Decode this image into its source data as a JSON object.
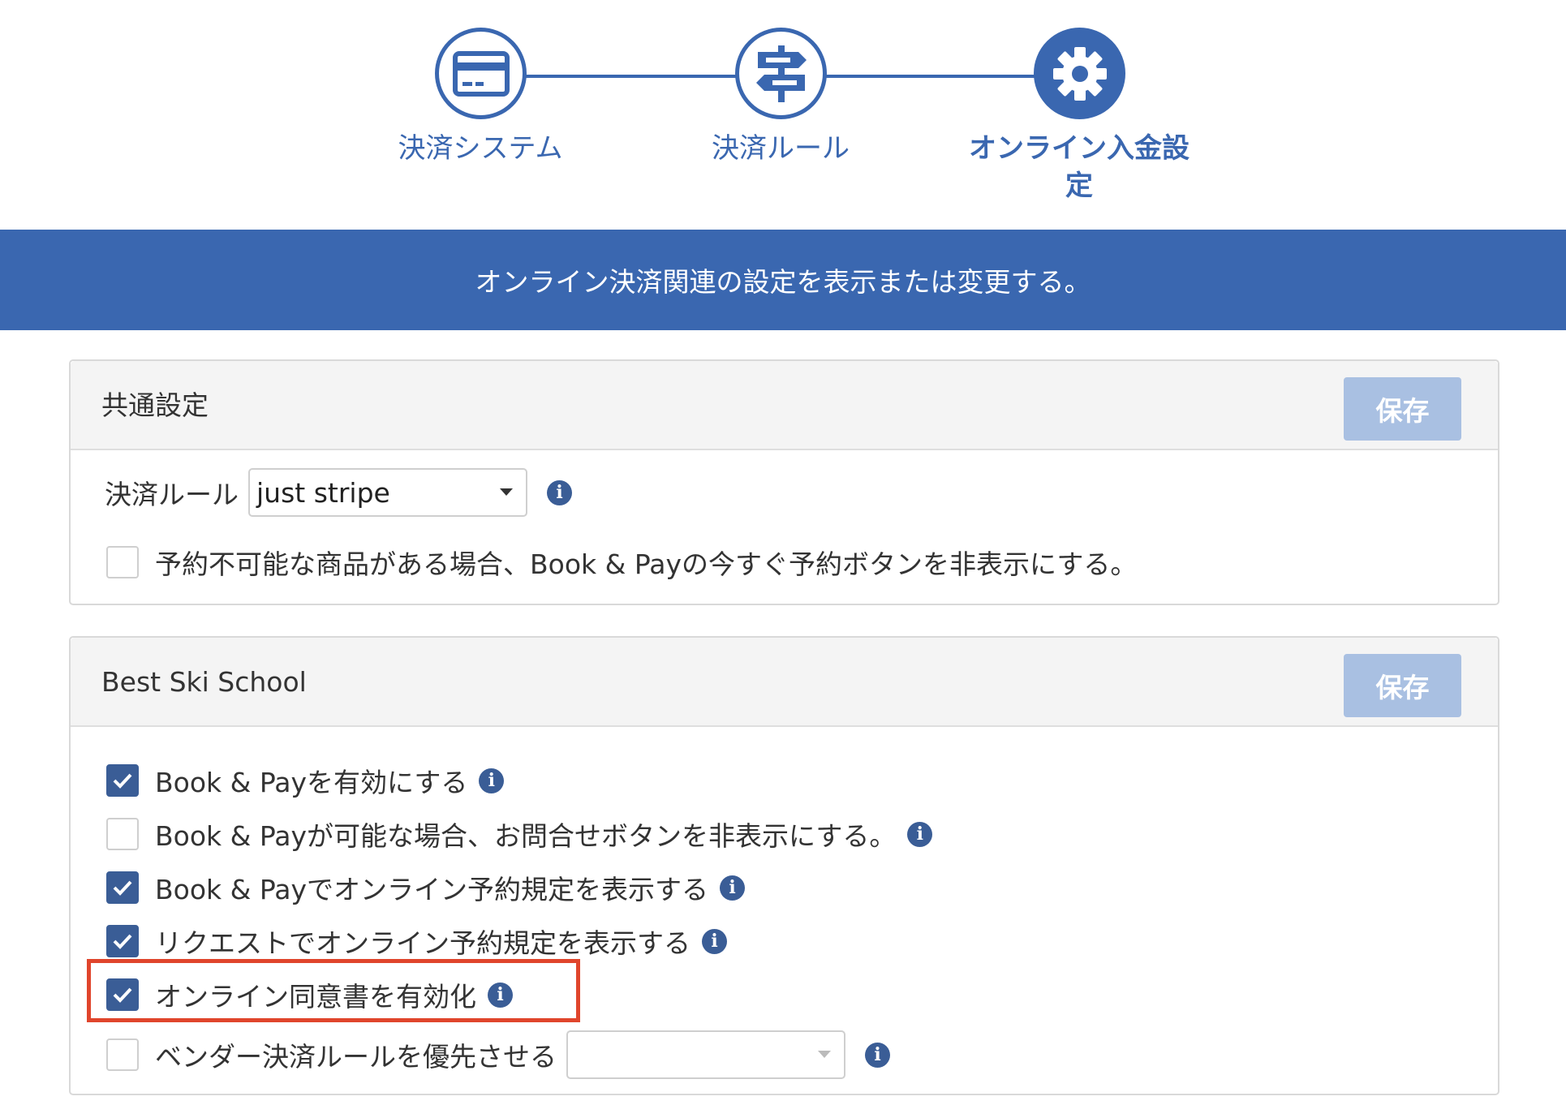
{
  "stepper": {
    "steps": [
      {
        "label": "決済システム",
        "icon": "credit-card-icon",
        "active": false
      },
      {
        "label": "決済ルール",
        "icon": "signpost-icon",
        "active": false
      },
      {
        "label": "オンライン入金設定",
        "icon": "gear-icon",
        "active": true
      }
    ]
  },
  "banner": {
    "text": "オンライン決済関連の設定を表示または変更する。"
  },
  "common_panel": {
    "title": "共通設定",
    "save_label": "保存",
    "rule_label": "決済ルール",
    "rule_select_value": "just stripe",
    "hide_book_now_label": "予約不可能な商品がある場合、Book & Payの今すぐ予約ボタンを非表示にする。",
    "hide_book_now_checked": false
  },
  "school_panel": {
    "title": "Best Ski School",
    "save_label": "保存",
    "options": [
      {
        "label": "Book & Payを有効にする",
        "checked": true,
        "info": true
      },
      {
        "label": "Book & Payが可能な場合、お問合せボタンを非表示にする。",
        "checked": false,
        "info": true
      },
      {
        "label": "Book & Payでオンライン予約規定を表示する",
        "checked": true,
        "info": true
      },
      {
        "label": "リクエストでオンライン予約規定を表示する",
        "checked": true,
        "info": true
      },
      {
        "label": "オンライン同意書を有効化",
        "checked": true,
        "info": true,
        "highlighted": true
      },
      {
        "label": "ベンダー決済ルールを優先させる",
        "checked": false,
        "info": true,
        "select_value": ""
      }
    ]
  },
  "colors": {
    "brand_blue": "#3a67b0",
    "checkbox_blue": "#3a5d96",
    "save_button_disabled": "#a9c0e2",
    "highlight_red": "#e0452c"
  }
}
